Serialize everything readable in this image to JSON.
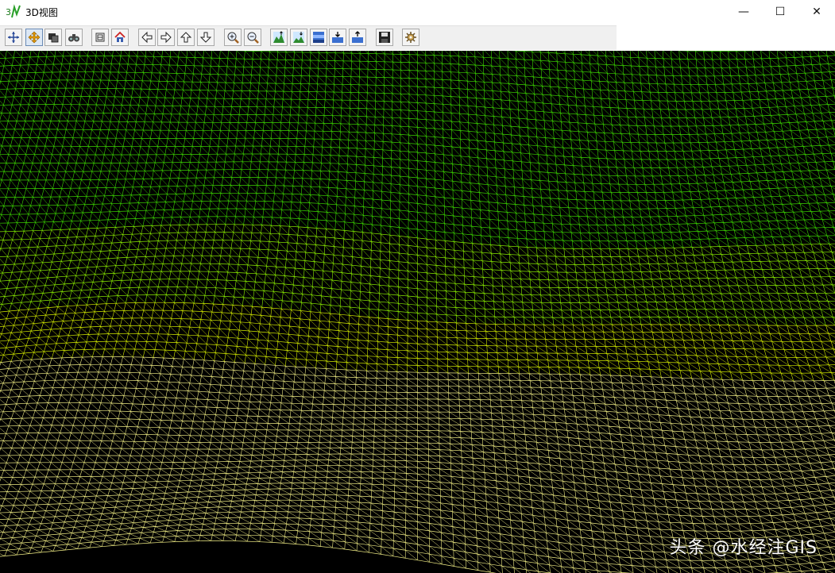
{
  "window": {
    "title": "3D视图",
    "app_icon": "terrain-app-icon",
    "controls": {
      "minimize_glyph": "—",
      "maximize_glyph": "☐",
      "close_glyph": "✕"
    }
  },
  "toolbar": {
    "buttons": [
      {
        "name": "rotate-tool-button",
        "icon": "rotate-icon",
        "active": false
      },
      {
        "name": "pan-tool-button",
        "icon": "pan-icon",
        "active": true
      },
      {
        "name": "layer-tool-button",
        "icon": "layer-icon",
        "active": false
      },
      {
        "name": "flythrough-button",
        "icon": "binoculars-icon",
        "active": false
      },
      {
        "name": "full-extent-button",
        "icon": "extent-icon",
        "active": false
      },
      {
        "name": "home-view-button",
        "icon": "home-icon",
        "active": false
      },
      {
        "name": "move-left-button",
        "icon": "arrow-left-icon",
        "active": false
      },
      {
        "name": "move-right-button",
        "icon": "arrow-right-icon",
        "active": false
      },
      {
        "name": "move-up-button",
        "icon": "arrow-up-icon",
        "active": false
      },
      {
        "name": "move-down-button",
        "icon": "arrow-down-icon",
        "active": false
      },
      {
        "name": "zoom-in-button",
        "icon": "zoom-in-icon",
        "active": false
      },
      {
        "name": "zoom-out-button",
        "icon": "zoom-out-icon",
        "active": false
      },
      {
        "name": "terrain-exaggerate-button",
        "icon": "terrain-up-icon",
        "active": false
      },
      {
        "name": "terrain-flatten-button",
        "icon": "terrain-down-icon",
        "active": false
      },
      {
        "name": "water-level-button",
        "icon": "water-level-icon",
        "active": false
      },
      {
        "name": "water-lower-button",
        "icon": "water-lower-icon",
        "active": false
      },
      {
        "name": "water-raise-button",
        "icon": "water-raise-icon",
        "active": false
      },
      {
        "name": "save-button",
        "icon": "save-icon",
        "active": false
      },
      {
        "name": "settings-button",
        "icon": "settings-icon",
        "active": false
      }
    ]
  },
  "viewport": {
    "render_mode": "wireframe TIN terrain",
    "colors": {
      "background": "#000000",
      "low": "#f0ee7a",
      "mid": "#e6f000",
      "high": "#38d400"
    }
  },
  "watermark": "头条 @水经注GIS"
}
